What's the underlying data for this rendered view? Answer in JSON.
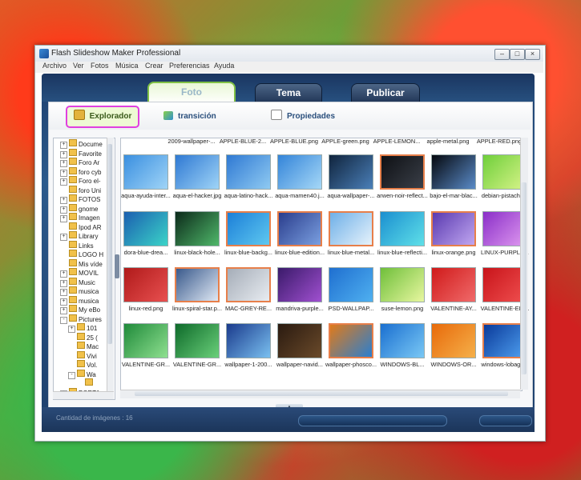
{
  "window": {
    "title": "Flash Slideshow Maker Professional",
    "min_icon": "minimize-icon",
    "max_icon": "maximize-icon",
    "close_icon": "close-icon"
  },
  "menu": [
    "Archivo",
    "Ver",
    "Fotos",
    "Música",
    "Crear",
    "Preferencias",
    "Ayuda"
  ],
  "tabs": [
    {
      "label": "Foto",
      "active": true
    },
    {
      "label": "Tema",
      "active": false
    },
    {
      "label": "Publicar",
      "active": false
    }
  ],
  "subtabs": [
    {
      "label": "Explorador",
      "icon": "explorer-icon",
      "selected": true
    },
    {
      "label": "transición",
      "icon": "transition-icon",
      "selected": false
    },
    {
      "label": "Propiedades",
      "icon": "properties-icon",
      "selected": false
    }
  ],
  "tree": [
    {
      "label": "Docume",
      "exp": "+",
      "level": 0
    },
    {
      "label": "Favorite",
      "exp": "+",
      "level": 0
    },
    {
      "label": "Foro Ar",
      "exp": "+",
      "level": 0
    },
    {
      "label": "foro cyb",
      "exp": "+",
      "level": 0
    },
    {
      "label": "Foro el-",
      "exp": "+",
      "level": 0
    },
    {
      "label": "foro Uni",
      "exp": "",
      "level": 0
    },
    {
      "label": "FOTOS",
      "exp": "+",
      "level": 0
    },
    {
      "label": "gnome",
      "exp": "+",
      "level": 0
    },
    {
      "label": "Imagen",
      "exp": "+",
      "level": 0
    },
    {
      "label": "Ipod AR",
      "exp": "",
      "level": 0
    },
    {
      "label": "Library",
      "exp": "+",
      "level": 0
    },
    {
      "label": "Links",
      "exp": "",
      "level": 0
    },
    {
      "label": "LOGO H",
      "exp": "",
      "level": 0
    },
    {
      "label": "Mis víde",
      "exp": "",
      "level": 0
    },
    {
      "label": "MOVIL",
      "exp": "+",
      "level": 0
    },
    {
      "label": "Music",
      "exp": "+",
      "level": 0
    },
    {
      "label": "musica",
      "exp": "+",
      "level": 0
    },
    {
      "label": "musica",
      "exp": "+",
      "level": 0
    },
    {
      "label": "My eBo",
      "exp": "+",
      "level": 0
    },
    {
      "label": "Pictures",
      "exp": "-",
      "level": 0
    },
    {
      "label": "101",
      "exp": "+",
      "level": 1
    },
    {
      "label": "25 (",
      "exp": "",
      "level": 1
    },
    {
      "label": "Mac",
      "exp": "",
      "level": 1
    },
    {
      "label": "Vivi",
      "exp": "",
      "level": 1
    },
    {
      "label": "Vol.",
      "exp": "",
      "level": 1
    },
    {
      "label": "Wa",
      "exp": "-",
      "level": 1
    },
    {
      "label": "",
      "exp": "",
      "level": 2
    },
    {
      "label": "PORTA",
      "exp": "+",
      "level": 0
    }
  ],
  "top_captions": [
    "2009-wallpaper-...",
    "APPLE-BLUE-2...",
    "APPLE-BLUE.png",
    "APPLE-green.png",
    "APPLE-LEMON...",
    "apple-metal.png",
    "APPLE-RED.png"
  ],
  "images": [
    {
      "caption": "aqua-ayuda-inter...",
      "c1": "#3a8fe0",
      "c2": "#9fd4f7",
      "hl": false
    },
    {
      "caption": "aqua-el-hacker.jpg",
      "c1": "#2f79d3",
      "c2": "#9fd4f7",
      "hl": false
    },
    {
      "caption": "aqua-latino-hack...",
      "c1": "#2f79d3",
      "c2": "#8fcaf2",
      "hl": false
    },
    {
      "caption": "aqua-mamen40.j...",
      "c1": "#3384d9",
      "c2": "#a6d8f7",
      "hl": false
    },
    {
      "caption": "aqua-wallpaper-...",
      "c1": "#10243d",
      "c2": "#4a7fb8",
      "hl": false
    },
    {
      "caption": "arwen-noir-reflect...",
      "c1": "#0e1014",
      "c2": "#3a3f48",
      "hl": true
    },
    {
      "caption": "bajo-el-mar-blac...",
      "c1": "#05080e",
      "c2": "#5a8bc8",
      "hl": false
    },
    {
      "caption": "debian-pistache...",
      "c1": "#6fcf3a",
      "c2": "#d9f48a",
      "hl": false
    },
    {
      "caption": "dora-blue-drea...",
      "c1": "#1b5fb0",
      "c2": "#3bd4c8",
      "hl": false
    },
    {
      "caption": "linux-black-hole...",
      "c1": "#0c2a1a",
      "c2": "#4fb86a",
      "hl": false
    },
    {
      "caption": "linux-blue-backg...",
      "c1": "#1c7fd8",
      "c2": "#5ec8f0",
      "hl": true
    },
    {
      "caption": "linux-blue-edition...",
      "c1": "#2a3d8c",
      "c2": "#7a9fe0",
      "hl": true
    },
    {
      "caption": "linux-blue-metal...",
      "c1": "#6fb0e8",
      "c2": "#e6f2fb",
      "hl": true
    },
    {
      "caption": "linux-blue-reflecti...",
      "c1": "#1b8fd0",
      "c2": "#5fe0e8",
      "hl": false
    },
    {
      "caption": "linux-orange.png",
      "c1": "#5a3ab0",
      "c2": "#c0a6f0",
      "hl": true
    },
    {
      "caption": "LINUX-PURPLE...",
      "c1": "#8a2fc8",
      "c2": "#e09af0",
      "hl": false
    },
    {
      "caption": "linux-red.png",
      "c1": "#b01a1a",
      "c2": "#e85050",
      "hl": false
    },
    {
      "caption": "linux-spiral-star.p...",
      "c1": "#3a5a8c",
      "c2": "#dfe8f4",
      "hl": true
    },
    {
      "caption": "MAC-GREY-RE...",
      "c1": "#a5adb8",
      "c2": "#e8ecf1",
      "hl": true
    },
    {
      "caption": "mandriva-purple...",
      "c1": "#3a1a6a",
      "c2": "#a050d0",
      "hl": false
    },
    {
      "caption": "PSD-WALLPAP...",
      "c1": "#1f6fd0",
      "c2": "#4fb0f0",
      "hl": false
    },
    {
      "caption": "suse-lemon.png",
      "c1": "#6fbf3a",
      "c2": "#e8f7a0",
      "hl": false
    },
    {
      "caption": "VALENTINE-AY...",
      "c1": "#d01a1a",
      "c2": "#f06a6a",
      "hl": false
    },
    {
      "caption": "VALENTINE-EL-...",
      "c1": "#c8141a",
      "c2": "#f05050",
      "hl": false
    },
    {
      "caption": "VALENTINE-GR...",
      "c1": "#1f8a3a",
      "c2": "#8fe090",
      "hl": false
    },
    {
      "caption": "VALENTINE-GR...",
      "c1": "#0e6a2a",
      "c2": "#6ad07a",
      "hl": false
    },
    {
      "caption": "wallpaper-1-200...",
      "c1": "#1a3a8c",
      "c2": "#7ac0f0",
      "hl": false
    },
    {
      "caption": "wallpaper-navid...",
      "c1": "#2a1a10",
      "c2": "#6a4a2a",
      "hl": false
    },
    {
      "caption": "wallpaper-phosco...",
      "c1": "#e07a1a",
      "c2": "#2a7fd0",
      "hl": true
    },
    {
      "caption": "WINDOWS-BL...",
      "c1": "#1a6fd0",
      "c2": "#7ac8f5",
      "hl": false
    },
    {
      "caption": "WINDOWS-OR...",
      "c1": "#e86a0a",
      "c2": "#f5b04a",
      "hl": false
    },
    {
      "caption": "windows-lobaga...",
      "c1": "#0a3a9a",
      "c2": "#4fa0f0",
      "hl": true
    }
  ],
  "status": "Cantidad de imágenes : 16"
}
